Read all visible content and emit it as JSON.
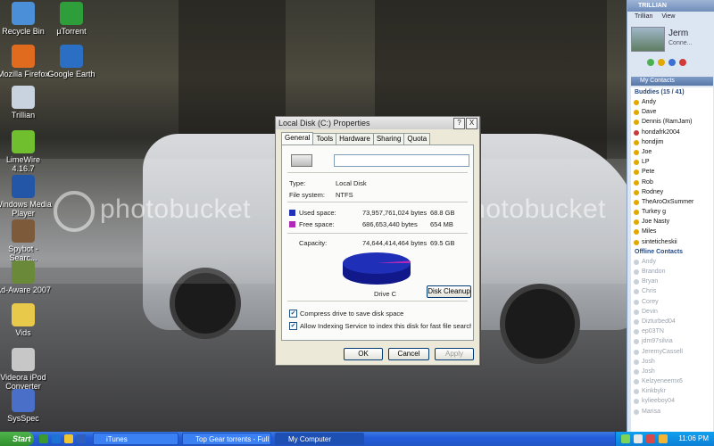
{
  "desktop_icons": [
    {
      "label": "Recycle Bin",
      "icon": "recycle-bin-icon",
      "color": "#4a8fd8"
    },
    {
      "label": "µTorrent",
      "icon": "utorrent-icon",
      "color": "#2e9e3a"
    },
    {
      "label": "Mozilla Firefox",
      "icon": "firefox-icon",
      "color": "#e06a1e"
    },
    {
      "label": "Google Earth",
      "icon": "google-earth-icon",
      "color": "#2a6fc4"
    },
    {
      "label": "Trillian",
      "icon": "trillian-icon",
      "color": "#c9d3df"
    },
    {
      "label": "LimeWire 4.16.7",
      "icon": "limewire-icon",
      "color": "#6fbf2f"
    },
    {
      "label": "Windows Media Player",
      "icon": "media-player-icon",
      "color": "#2456a8"
    },
    {
      "label": "Spybot - Searc...",
      "icon": "spybot-icon",
      "color": "#7c5a3a"
    },
    {
      "label": "Ad-Aware 2007",
      "icon": "adaware-icon",
      "color": "#6a8a3a"
    },
    {
      "label": "Vids",
      "icon": "folder-icon",
      "color": "#e8c94a"
    },
    {
      "label": "Videora iPod Converter",
      "icon": "videora-icon",
      "color": "#c7c7c7"
    },
    {
      "label": "SysSpec",
      "icon": "sysspec-icon",
      "color": "#4a6fc9"
    }
  ],
  "watermark": {
    "text": "photobucket"
  },
  "dialog": {
    "title": "Local Disk (C:) Properties",
    "help_btn": "?",
    "close_btn": "X",
    "tabs": [
      "General",
      "Tools",
      "Hardware",
      "Sharing",
      "Quota"
    ],
    "type_label": "Type:",
    "type_value": "Local Disk",
    "fs_label": "File system:",
    "fs_value": "NTFS",
    "used_label": "Used space:",
    "used_bytes": "73,957,761,024 bytes",
    "used_gb": "68.8 GB",
    "free_label": "Free space:",
    "free_bytes": "686,653,440 bytes",
    "free_mb": "654 MB",
    "capacity_label": "Capacity:",
    "capacity_bytes": "74,644,414,464 bytes",
    "capacity_gb": "69.5 GB",
    "drive_label": "Drive C",
    "cleanup_btn": "Disk Cleanup",
    "compress_label": "Compress drive to save disk space",
    "index_label": "Allow Indexing Service to index this disk for fast file searching",
    "ok_btn": "OK",
    "cancel_btn": "Cancel",
    "apply_btn": "Apply",
    "used_color": "#1f2fb8",
    "free_color": "#b028b8"
  },
  "trillian": {
    "title": "TRILLIAN",
    "menu": [
      "Trillian",
      "View"
    ],
    "user_name": "Jerm",
    "user_status": "Conne...",
    "contacts_header": "My Contacts",
    "buddies_group": "Buddies (15 / 41)",
    "online": [
      "Andy",
      "Dave",
      "Dennis (RamJam)",
      "hondafrk2004",
      "hondjim",
      "Joe",
      "LP",
      "Pete",
      "Rob",
      "Rodney",
      "TheAroOxSummer",
      "Turkey g",
      "Joe Nasty",
      "Miles",
      "sinteticheskii"
    ],
    "offline_group": "Offline Contacts",
    "offline": [
      "Andy",
      "Brandon",
      "Bryan",
      "Chris",
      "Corey",
      "Devin",
      "Dizturbed04",
      "ep03TN",
      "jdm97silvia",
      "JeremyCassell",
      "Josh",
      "Josh",
      "Kelzyeneemx6",
      "Kinkbykr",
      "kylieeboy04",
      "Marisa"
    ]
  },
  "taskbar": {
    "start": "Start",
    "tasks": [
      "iTunes",
      "Top Gear torrents - Full ...",
      "My Computer"
    ],
    "clock": "11:06 PM"
  }
}
